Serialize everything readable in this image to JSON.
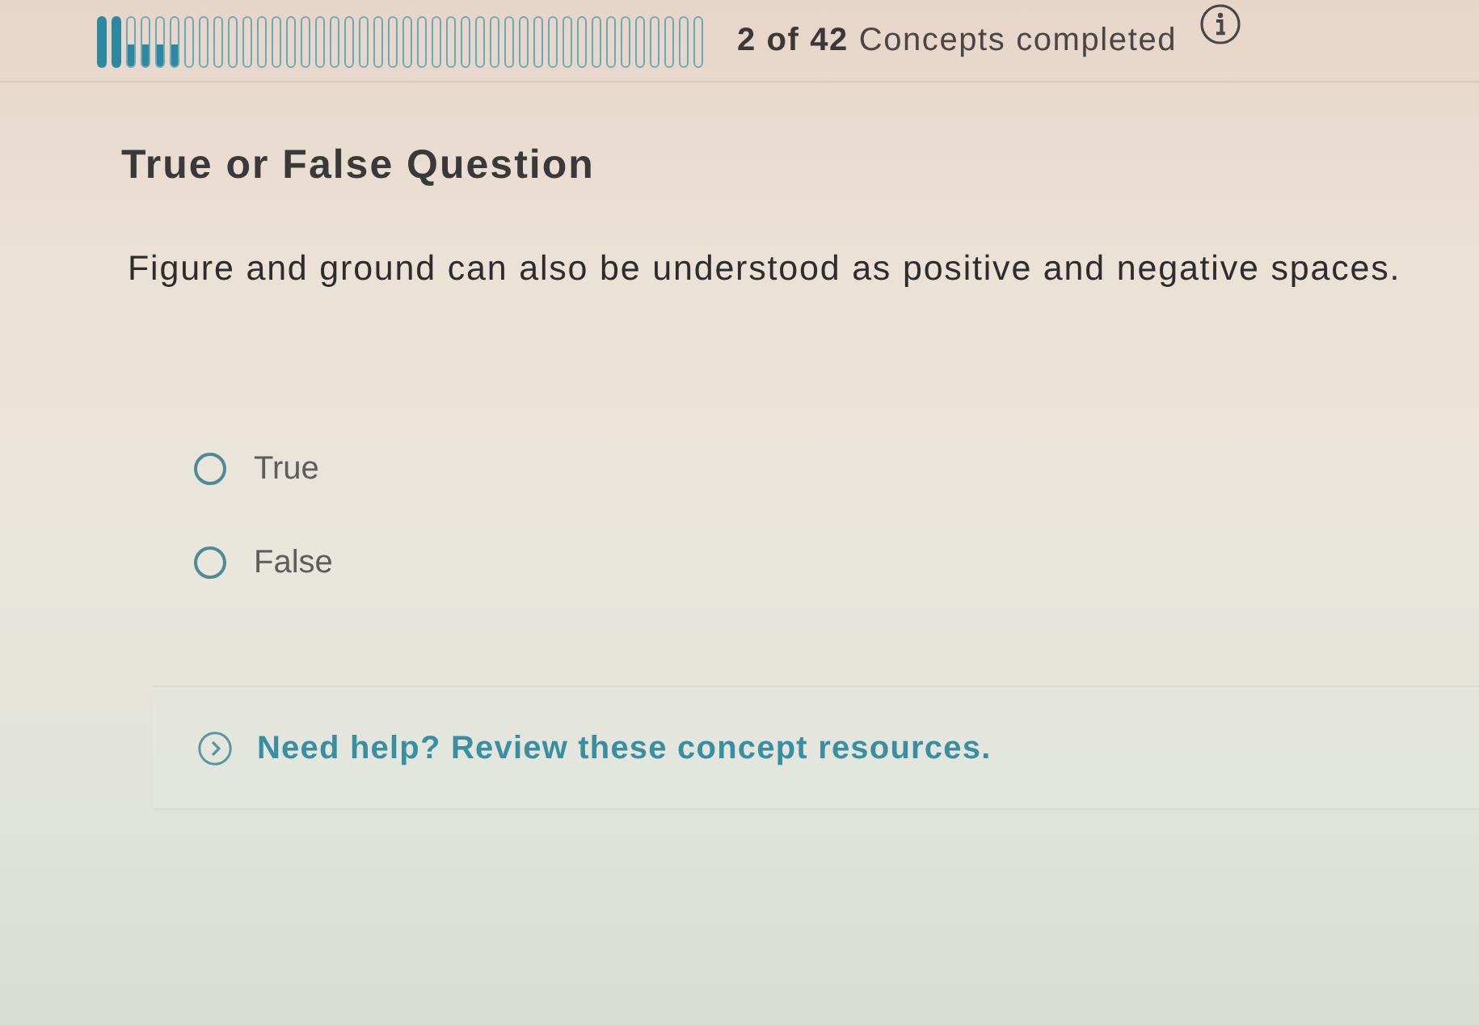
{
  "progress": {
    "segments": [
      {
        "kind": "completed"
      },
      {
        "kind": "completed"
      },
      {
        "kind": "in_progress"
      },
      {
        "kind": "in_progress"
      },
      {
        "kind": "in_progress"
      },
      {
        "kind": "in_progress"
      },
      {
        "kind": "not_started"
      },
      {
        "kind": "not_started"
      },
      {
        "kind": "not_started"
      },
      {
        "kind": "not_started"
      },
      {
        "kind": "not_started"
      },
      {
        "kind": "not_started"
      },
      {
        "kind": "not_started"
      },
      {
        "kind": "not_started"
      },
      {
        "kind": "not_started"
      },
      {
        "kind": "not_started"
      },
      {
        "kind": "not_started"
      },
      {
        "kind": "not_started"
      },
      {
        "kind": "not_started"
      },
      {
        "kind": "not_started"
      },
      {
        "kind": "not_started"
      },
      {
        "kind": "not_started"
      },
      {
        "kind": "not_started"
      },
      {
        "kind": "not_started"
      },
      {
        "kind": "not_started"
      },
      {
        "kind": "not_started"
      },
      {
        "kind": "not_started"
      },
      {
        "kind": "not_started"
      },
      {
        "kind": "not_started"
      },
      {
        "kind": "not_started"
      },
      {
        "kind": "not_started"
      },
      {
        "kind": "not_started"
      },
      {
        "kind": "not_started"
      },
      {
        "kind": "not_started"
      },
      {
        "kind": "not_started"
      },
      {
        "kind": "not_started"
      },
      {
        "kind": "not_started"
      },
      {
        "kind": "not_started"
      },
      {
        "kind": "not_started"
      },
      {
        "kind": "not_started"
      },
      {
        "kind": "not_started"
      },
      {
        "kind": "not_started"
      }
    ]
  },
  "status": {
    "text": "**2 of 42** Concepts completed"
  },
  "question": {
    "type": "True or False Question",
    "prompt": "Figure and ground can also be understood as positive and negative spaces.",
    "options": [
      {
        "label": "True",
        "selected": false
      },
      {
        "label": "False",
        "selected": false
      }
    ]
  },
  "help": {
    "text": "Need help? Review these concept resources.",
    "expanded": false
  }
}
